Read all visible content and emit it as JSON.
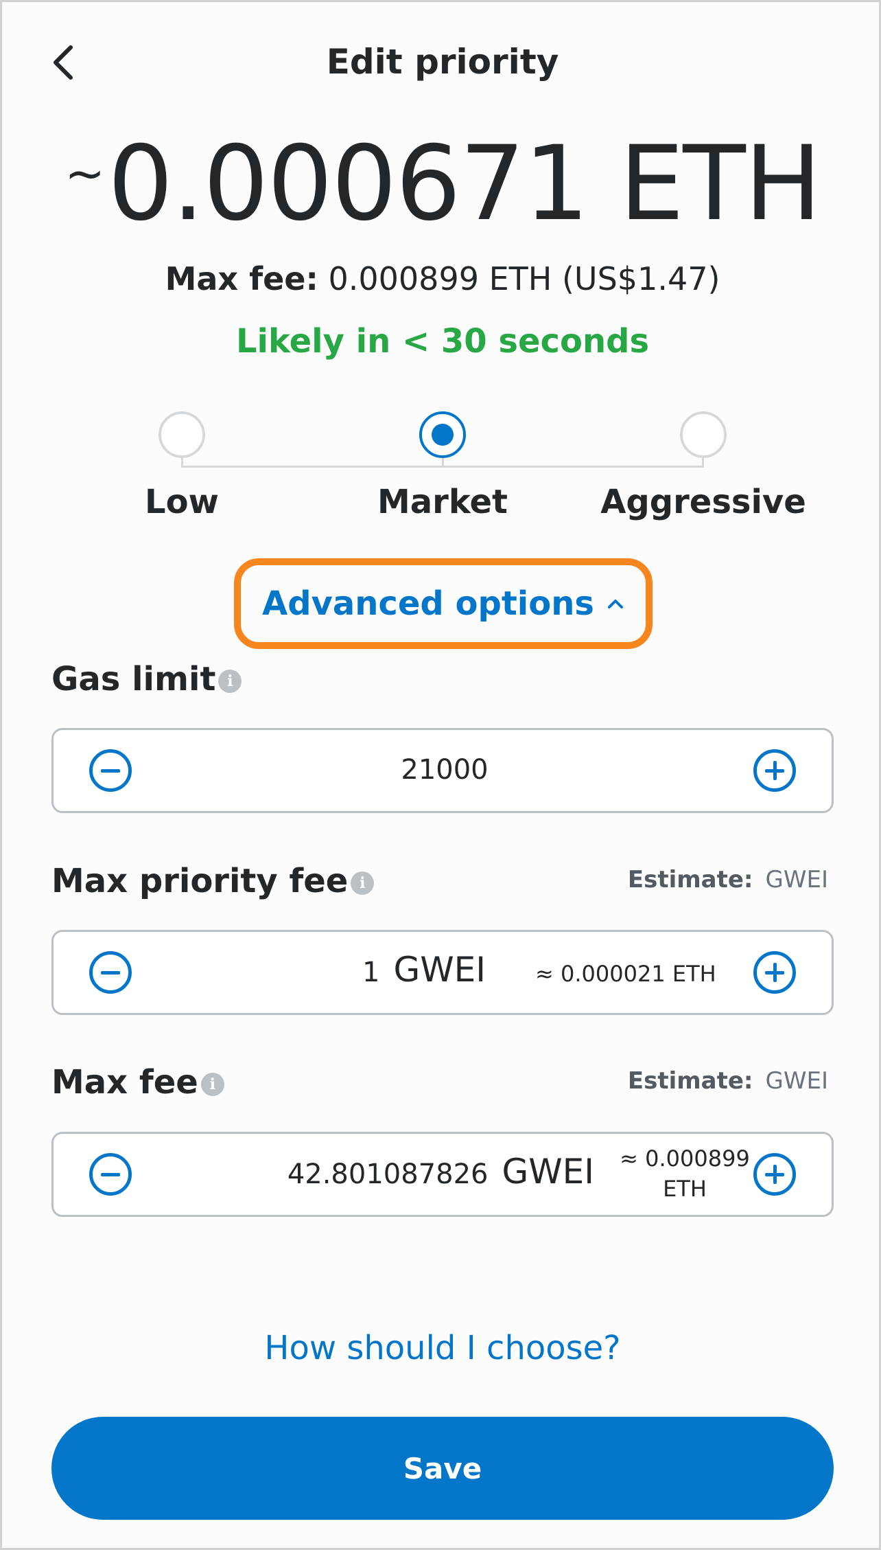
{
  "colors": {
    "primary": "#0376c9",
    "success": "#28a745",
    "highlight": "#f8861e",
    "border": "#bbc0c5"
  },
  "header": {
    "back_icon": "chevron-left-icon",
    "title": "Edit priority"
  },
  "summary": {
    "tilde": "~",
    "estimated_amount": "0.000671 ETH",
    "max_fee_label": "Max fee:",
    "max_fee_value": " 0.000899 ETH (US$1.47)",
    "likely_text": "Likely in < 30 seconds"
  },
  "priority_options": {
    "selected": "Market",
    "items": [
      {
        "label": "Low"
      },
      {
        "label": "Market"
      },
      {
        "label": "Aggressive"
      }
    ]
  },
  "advanced": {
    "label": "Advanced options",
    "chevron_icon": "chevron-up-icon"
  },
  "gas_limit": {
    "label": "Gas limit",
    "info_icon": "info-icon",
    "value": "21000"
  },
  "max_priority_fee": {
    "label": "Max priority fee",
    "estimate_label": "Estimate:",
    "estimate_value": "GWEI",
    "value": "1",
    "unit": "GWEI",
    "approx": "≈ 0.000021 ETH"
  },
  "max_fee": {
    "label": "Max fee",
    "estimate_label": "Estimate:",
    "estimate_value": "GWEI",
    "value": "42.801087826",
    "unit": "GWEI",
    "approx_line1": "≈ 0.000899",
    "approx_line2": "ETH"
  },
  "footer": {
    "help_link": "How should I choose?",
    "save_label": "Save"
  }
}
